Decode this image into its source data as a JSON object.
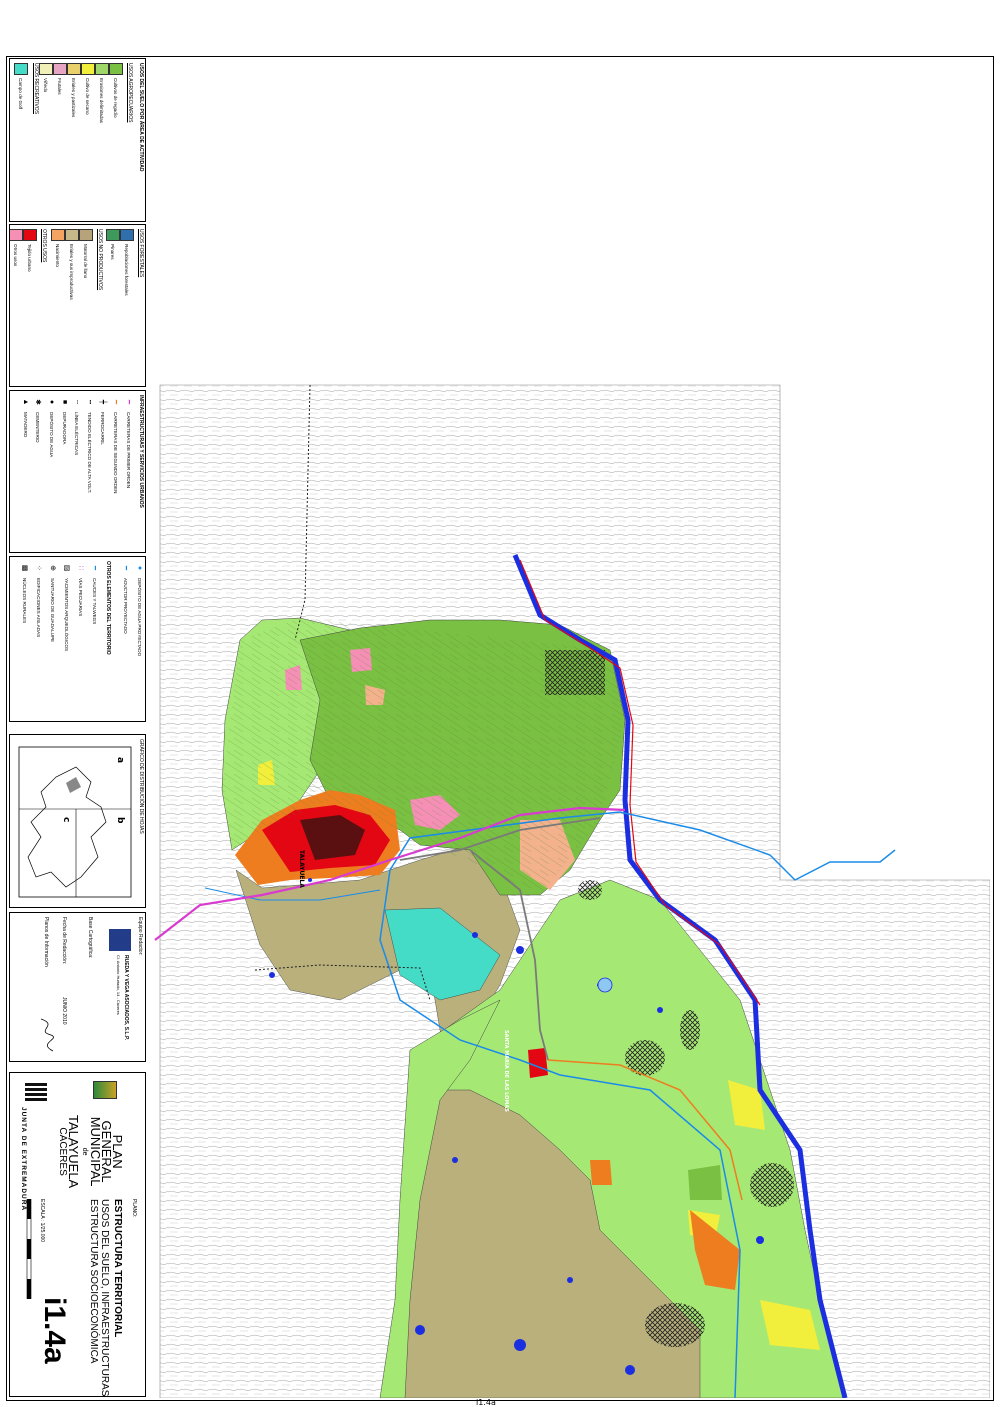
{
  "sheet_id": "i1.4a",
  "legend_agricultural": {
    "title": "USOS DEL SUELO POR ÁREA DE ACTIVIDAD",
    "group1": "USOS AGROPECUARIOS",
    "items": [
      {
        "label": "Cultivos de regadío",
        "color": "#7ac043"
      },
      {
        "label": "Erosiones delimitadas",
        "color": "#9fd869"
      },
      {
        "label": "Cultivo de secano",
        "color": "#f2ee3c"
      },
      {
        "label": "Eriales y pastizales",
        "color": "#e9d06a"
      },
      {
        "label": "Frutales",
        "color": "#e8a5c3"
      },
      {
        "label": "Viñedo",
        "color": "#f0f0b8"
      }
    ],
    "group2": "USOS RECREATIVOS",
    "items2": [
      {
        "label": "Campo de Golf",
        "color": "#44dcc6"
      }
    ]
  },
  "legend_forest": {
    "group1": "USOS FORESTALES",
    "items": [
      {
        "label": "Repoblaciones forestales",
        "color": "#2f6fae"
      },
      {
        "label": "Pinares",
        "color": "#3d9a5a"
      }
    ],
    "group2": "USOS NO PRODUCTIVOS",
    "items2": [
      {
        "label": "Matorral de llano",
        "color": "#b6a37a"
      },
      {
        "label": "Eriales y sus improductivas",
        "color": "#c8b889"
      },
      {
        "label": "Nacimiento",
        "color": "#f4a460"
      }
    ],
    "group3": "OTROS USOS",
    "items3": [
      {
        "label": "Tejido urbano",
        "color": "#e30613"
      },
      {
        "label": "Otros usos",
        "color": "#f58fb5"
      }
    ]
  },
  "legend_infra": {
    "title": "INFRAESTRUCTURAS Y SERVICIOS URBANOS",
    "items": [
      {
        "label": "CARRETERAS DE PRIMER ORDEN",
        "symbol": "line-magenta"
      },
      {
        "label": "CARRETERAS DE SEGUNDO ORDEN",
        "symbol": "line-orange"
      },
      {
        "label": "FERROCARRIL",
        "symbol": "line-rail"
      },
      {
        "label": "TENDIDO ELÉCTRICO DE ALTA VOLT.",
        "symbol": "line-power"
      },
      {
        "label": "LÍNEA ELÉCTRICAS",
        "symbol": "line-dash"
      },
      {
        "label": "DEPURADORA",
        "symbol": "square"
      },
      {
        "label": "DEPÓSITO DE AGUA",
        "symbol": "circle"
      },
      {
        "label": "CEMENTERIO",
        "symbol": "star"
      },
      {
        "label": "MATADERO",
        "symbol": "triangle"
      }
    ]
  },
  "legend_territory": {
    "items_top": [
      {
        "label": "DEPÓSITO DE AGUA PROYECTADO",
        "symbol": "circle-blue"
      },
      {
        "label": "ADUCTOR PROYECTADO",
        "symbol": "line-blue"
      }
    ],
    "title": "OTROS ELEMENTOS DEL TERRITORIO",
    "items": [
      {
        "label": "CAUCES Y TALWEGS",
        "symbol": "line-blue-dots"
      },
      {
        "label": "VÍAS PECUARIAS",
        "symbol": "dots-magenta"
      },
      {
        "label": "YACIMIENTOS ARQUEOLÓGICOS",
        "symbol": "hatch"
      },
      {
        "label": "SANTUARIO DE GUADALUPE",
        "symbol": "circle-cross"
      },
      {
        "label": "EDIFICACIONES AISLADAS",
        "symbol": "dots"
      },
      {
        "label": "NÚCLEOS RURALES",
        "symbol": "cross-hatch"
      }
    ]
  },
  "distribution": {
    "title": "GRÁFICO DE DISTRIBUCIÓN DE HOJAS",
    "sheets": [
      "a",
      "b",
      "c"
    ]
  },
  "credits": {
    "team_label": "Equipo Redactor:",
    "firm": "RUEDA Y VEGA ASOCIADOS, S.L.P.",
    "firm_address": "Cl. Antonio Hurtado, 14 - Cáceres",
    "base_label": "Base Cartográfica:",
    "date_label": "Fecha de Redacción:",
    "date_value": "JUNIO 2010",
    "info_label": "Planos de Información"
  },
  "title_block": {
    "plan_title": [
      "PLAN",
      "GENERAL",
      "MUNICIPAL"
    ],
    "of": "de",
    "municipality": "TALAYUELA",
    "province": "CÁCERES",
    "plano_label": "PLANO:",
    "plano_title": "ESTRUCTURA TERRITORIAL",
    "plano_sub1": "USOS DEL SUELO, INFRAESTRUCTURAS",
    "plano_sub2": "ESTRUCTURA SOCIOECONÓMICA",
    "number": "i1.4a",
    "scale": "ESCALA : 1/25.000",
    "government": "JUNTA DE EXTREMADURA"
  },
  "map_labels": [
    "TALAYUELA",
    "SANTA MARÍA DE LAS LOMAS"
  ],
  "colors": {
    "irrigated": "#7ac043",
    "light_green": "#a6e874",
    "khaki": "#b9b07b",
    "urban": "#e30613",
    "urban_orange": "#ee7d1f",
    "golf": "#44dcc6",
    "river": "#1c2fe0",
    "road_magenta": "#d93ad0",
    "aqueduct": "#1a8be8",
    "pink": "#f58fb5",
    "salmon": "#f3b28c",
    "yellow": "#f2ee3c"
  }
}
